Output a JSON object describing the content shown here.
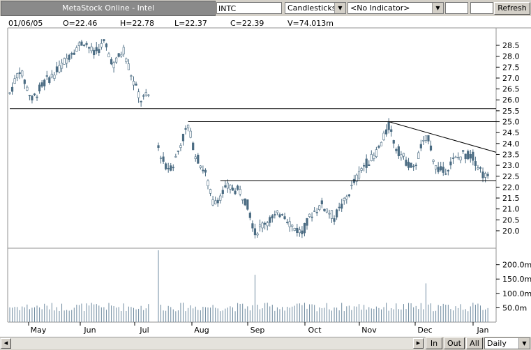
{
  "toolbar": {
    "title": "MetaStock Online - Intel",
    "symbol": "INTC",
    "chart_style": "Candlesticks",
    "indicator": "<No Indicator>",
    "refresh_label": "Refresh"
  },
  "header": {
    "date": "01/06/05",
    "open": "O=22.46",
    "high": "H=22.78",
    "low": "L=22.37",
    "close": "C=22.39",
    "volume": "V=74.013m"
  },
  "bottom": {
    "in_label": "In",
    "out_label": "Out",
    "all_label": "All",
    "period": "Daily"
  },
  "chart_data": {
    "type": "candlestick",
    "x_tick_labels": [
      "May",
      "Jun",
      "Jul",
      "Aug",
      "Sep",
      "Oct",
      "Nov",
      "Dec",
      "Jan"
    ],
    "y_tick_labels": [
      "28.5",
      "28.0",
      "27.5",
      "27.0",
      "26.5",
      "26.0",
      "25.5",
      "25.0",
      "24.5",
      "24.0",
      "23.5",
      "23.0",
      "22.5",
      "22.0",
      "21.5",
      "21.0",
      "20.5",
      "20.0"
    ],
    "ylim": [
      19.2,
      29.3
    ],
    "volume_tick_labels": [
      "200.0m",
      "150.0m",
      "100.0m",
      "50.0m"
    ],
    "volume_ylim": [
      0,
      255
    ],
    "anchors": [
      {
        "t": 0,
        "p": 26.3
      },
      {
        "t": 4,
        "p": 27.4
      },
      {
        "t": 9,
        "p": 26.0
      },
      {
        "t": 14,
        "p": 26.8
      },
      {
        "t": 19,
        "p": 27.3
      },
      {
        "t": 25,
        "p": 28.2
      },
      {
        "t": 30,
        "p": 28.7
      },
      {
        "t": 34,
        "p": 28.1
      },
      {
        "t": 38,
        "p": 28.6
      },
      {
        "t": 42,
        "p": 27.6
      },
      {
        "t": 46,
        "p": 28.3
      },
      {
        "t": 50,
        "p": 26.8
      },
      {
        "t": 53,
        "p": 26.0
      },
      {
        "t": 56,
        "p": 26.2
      },
      {
        "t": 60,
        "p": 23.8
      },
      {
        "t": 63,
        "p": 22.9
      },
      {
        "t": 66,
        "p": 23.0
      },
      {
        "t": 69,
        "p": 24.0
      },
      {
        "t": 72,
        "p": 24.8
      },
      {
        "t": 75,
        "p": 23.5
      },
      {
        "t": 79,
        "p": 22.6
      },
      {
        "t": 82,
        "p": 21.3
      },
      {
        "t": 85,
        "p": 21.6
      },
      {
        "t": 88,
        "p": 22.0
      },
      {
        "t": 93,
        "p": 21.8
      },
      {
        "t": 96,
        "p": 21.2
      },
      {
        "t": 99,
        "p": 19.9
      },
      {
        "t": 103,
        "p": 20.4
      },
      {
        "t": 107,
        "p": 20.6
      },
      {
        "t": 110,
        "p": 20.9
      },
      {
        "t": 114,
        "p": 20.2
      },
      {
        "t": 118,
        "p": 19.9
      },
      {
        "t": 122,
        "p": 20.8
      },
      {
        "t": 126,
        "p": 21.2
      },
      {
        "t": 131,
        "p": 20.6
      },
      {
        "t": 135,
        "p": 21.3
      },
      {
        "t": 139,
        "p": 22.2
      },
      {
        "t": 143,
        "p": 23.0
      },
      {
        "t": 147,
        "p": 23.4
      },
      {
        "t": 150,
        "p": 24.0
      },
      {
        "t": 153,
        "p": 24.8
      },
      {
        "t": 156,
        "p": 23.8
      },
      {
        "t": 160,
        "p": 23.2
      },
      {
        "t": 163,
        "p": 22.8
      },
      {
        "t": 166,
        "p": 23.8
      },
      {
        "t": 169,
        "p": 24.3
      },
      {
        "t": 172,
        "p": 22.9
      },
      {
        "t": 175,
        "p": 22.7
      },
      {
        "t": 179,
        "p": 23.2
      },
      {
        "t": 183,
        "p": 23.5
      },
      {
        "t": 187,
        "p": 23.4
      },
      {
        "t": 191,
        "p": 22.6
      },
      {
        "t": 193,
        "p": 22.4
      }
    ],
    "volume_spikes": [
      {
        "t": 60,
        "v": 250
      },
      {
        "t": 99,
        "v": 165
      },
      {
        "t": 168,
        "v": 135
      }
    ],
    "trendlines": [
      {
        "t1": 0,
        "p1": 25.6,
        "t2": 193,
        "p2": 25.6
      },
      {
        "t1": 72,
        "p1": 25.0,
        "t2": 193,
        "p2": 25.0
      },
      {
        "t1": 85,
        "p1": 22.3,
        "t2": 193,
        "p2": 22.3
      },
      {
        "t1": 153,
        "p1": 25.0,
        "t2": 193,
        "p2": 23.6
      }
    ]
  }
}
